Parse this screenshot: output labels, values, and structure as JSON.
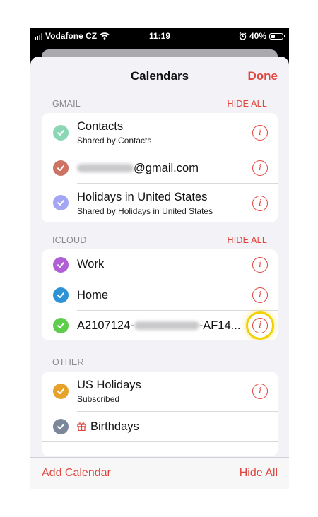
{
  "status_bar": {
    "carrier": "Vodafone CZ",
    "time": "11:19",
    "battery": "40%",
    "battery_level": 0.4
  },
  "navbar": {
    "title": "Calendars",
    "done_label": "Done"
  },
  "colors": {
    "accent": "#e0463e",
    "highlight": "#f0d000"
  },
  "sections": {
    "gmail": {
      "label": "GMAIL",
      "hide_all": "HIDE ALL",
      "rows": [
        {
          "name": "Contacts",
          "sub": "Shared by Contacts",
          "color": "#8bd7b5"
        },
        {
          "name": "@gmail.com",
          "color": "#cc7363"
        },
        {
          "name": "Holidays in United States",
          "sub": "Shared by Holidays in United States",
          "color": "#a4a6f5"
        }
      ]
    },
    "icloud": {
      "label": "ICLOUD",
      "hide_all": "HIDE ALL",
      "rows": [
        {
          "name": "Work",
          "color": "#b05fd6"
        },
        {
          "name": "Home",
          "color": "#2e93d6"
        },
        {
          "name_prefix": "A2107124-",
          "name_suffix": "-AF14...",
          "color": "#5fcd4c"
        }
      ]
    },
    "other": {
      "label": "OTHER",
      "rows": [
        {
          "name": "US Holidays",
          "sub": "Subscribed",
          "color": "#e6a32c"
        },
        {
          "name": "Birthdays",
          "color": "#7d879a"
        }
      ]
    }
  },
  "toolbar": {
    "add_calendar": "Add Calendar",
    "hide_all": "Hide All"
  }
}
